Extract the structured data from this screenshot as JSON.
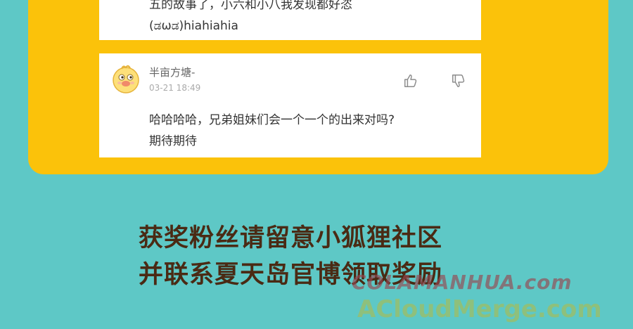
{
  "comments": [
    {
      "lines": [
        "五的故事了，小六和小八我发现都好恣",
        "(ಡωಡ)hiahiahia"
      ]
    },
    {
      "username": "半亩方塘-",
      "timestamp": "03-21 18:49",
      "lines": [
        "哈哈哈哈，兄弟姐妹们会一个一个的出来对吗?",
        "期待期待"
      ],
      "avatar_icon": "cartoon-chick-icon",
      "like_icon": "thumbs-up-icon",
      "dislike_icon": "thumbs-down-icon"
    }
  ],
  "promo": {
    "line1": "获奖粉丝请留意小狐狸社区",
    "line2": "并联系夏天岛官博领取奖励"
  },
  "watermarks": {
    "top": "COLAMANHUA.com",
    "bottom": "ACloudMerge.com"
  },
  "colors": {
    "background": "#5ec8c6",
    "panel": "#fbc20a",
    "card": "#ffffff",
    "promo_text": "#4a2a14"
  }
}
